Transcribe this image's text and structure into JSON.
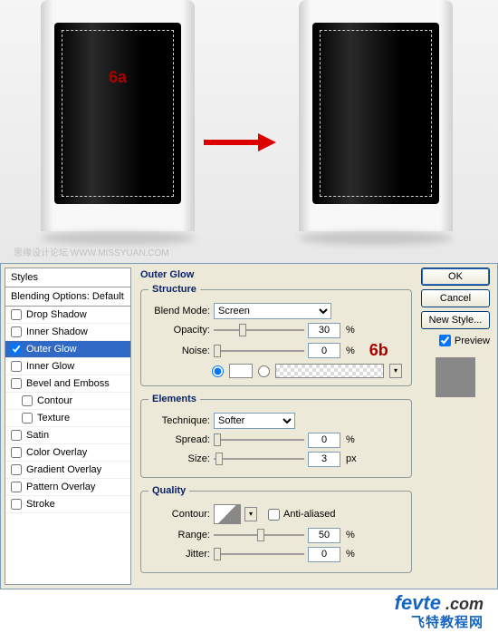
{
  "preview": {
    "label_6a": "6a",
    "watermark": "思缘设计论坛 WWW.MISSYUAN.COM"
  },
  "styles": {
    "header": "Styles",
    "blending_default": "Blending Options: Default",
    "items": [
      {
        "label": "Drop Shadow",
        "checked": false,
        "selected": false
      },
      {
        "label": "Inner Shadow",
        "checked": false,
        "selected": false
      },
      {
        "label": "Outer Glow",
        "checked": true,
        "selected": true
      },
      {
        "label": "Inner Glow",
        "checked": false,
        "selected": false
      },
      {
        "label": "Bevel and Emboss",
        "checked": false,
        "selected": false
      },
      {
        "label": "Contour",
        "checked": false,
        "selected": false,
        "nested": true
      },
      {
        "label": "Texture",
        "checked": false,
        "selected": false,
        "nested": true
      },
      {
        "label": "Satin",
        "checked": false,
        "selected": false
      },
      {
        "label": "Color Overlay",
        "checked": false,
        "selected": false
      },
      {
        "label": "Gradient Overlay",
        "checked": false,
        "selected": false
      },
      {
        "label": "Pattern Overlay",
        "checked": false,
        "selected": false
      },
      {
        "label": "Stroke",
        "checked": false,
        "selected": false
      }
    ]
  },
  "panel": {
    "title": "Outer Glow",
    "structure_legend": "Structure",
    "blend_mode_label": "Blend Mode:",
    "blend_mode_value": "Screen",
    "opacity_label": "Opacity:",
    "opacity_value": "30",
    "opacity_unit": "%",
    "noise_label": "Noise:",
    "noise_value": "0",
    "noise_unit": "%",
    "label_6b": "6b",
    "elements_legend": "Elements",
    "technique_label": "Technique:",
    "technique_value": "Softer",
    "spread_label": "Spread:",
    "spread_value": "0",
    "spread_unit": "%",
    "size_label": "Size:",
    "size_value": "3",
    "size_unit": "px",
    "quality_legend": "Quality",
    "contour_label": "Contour:",
    "antialiased_label": "Anti-aliased",
    "range_label": "Range:",
    "range_value": "50",
    "range_unit": "%",
    "jitter_label": "Jitter:",
    "jitter_value": "0",
    "jitter_unit": "%"
  },
  "buttons": {
    "ok": "OK",
    "cancel": "Cancel",
    "new_style": "New Style...",
    "preview": "Preview"
  },
  "footer": {
    "brand": "fevte",
    "domain": " .com",
    "subtitle": "飞特教程网"
  }
}
